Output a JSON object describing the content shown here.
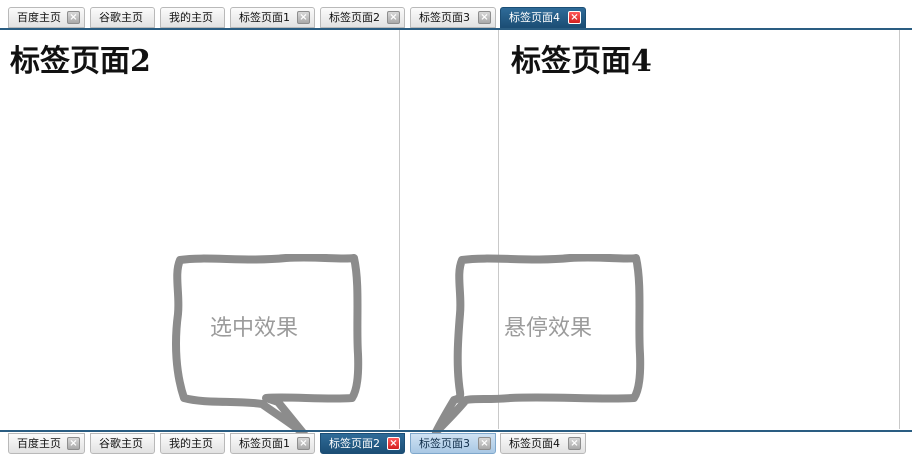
{
  "top_tabs": [
    {
      "label": "百度主页"
    },
    {
      "label": "谷歌主页"
    },
    {
      "label": "我的主页"
    },
    {
      "label": "标签页面1"
    },
    {
      "label": "标签页面2"
    },
    {
      "label": "标签页面3"
    },
    {
      "label": "标签页面4"
    }
  ],
  "bottom_tabs": [
    {
      "label": "百度主页"
    },
    {
      "label": "谷歌主页"
    },
    {
      "label": "我的主页"
    },
    {
      "label": "标签页面1"
    },
    {
      "label": "标签页面2"
    },
    {
      "label": "标签页面3"
    },
    {
      "label": "标签页面4"
    }
  ],
  "frames": {
    "left_title": "标签页面2",
    "right_title": "标签页面4"
  },
  "callouts": {
    "selected_label": "选中效果",
    "hover_label": "悬停效果"
  },
  "colors": {
    "selected_tab": "#1c4e75",
    "hover_tab": "#a9c8e4",
    "close_selected": "#d21f1f",
    "callout_stroke": "#8c8c8c"
  },
  "icons": {
    "close": "close-icon"
  }
}
